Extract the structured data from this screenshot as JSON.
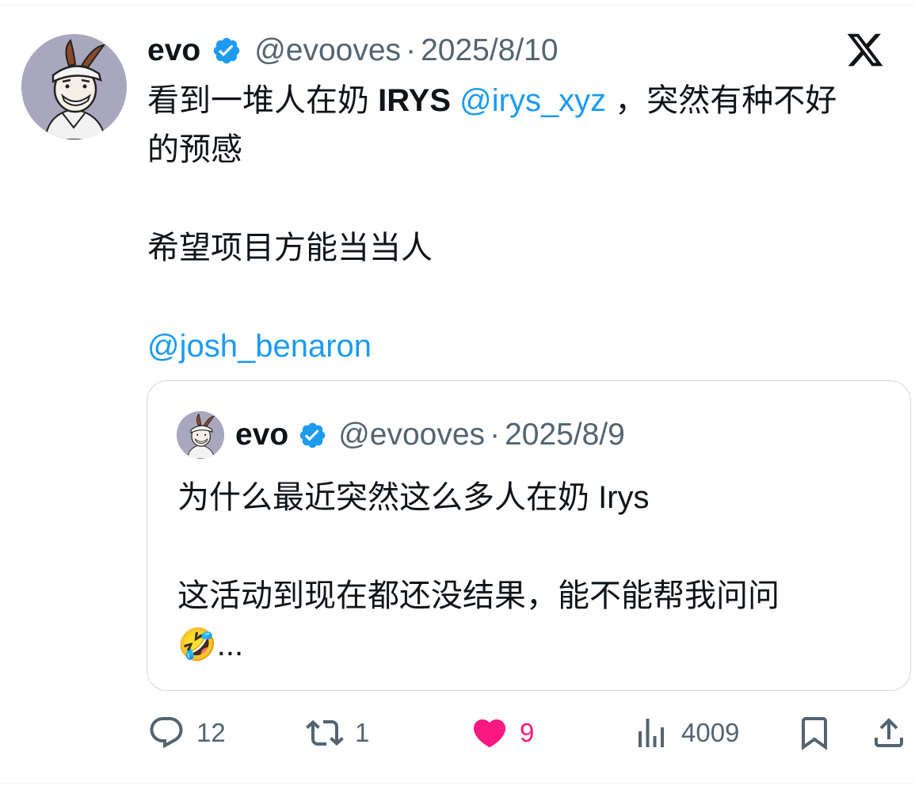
{
  "tweet": {
    "author_name": "evo",
    "handle": "@evooves",
    "separator": "·",
    "date": "2025/8/10",
    "line1_pre": "看到一堆人在奶 ",
    "line1_bold": "IRYS",
    "line1_space": " ",
    "line1_mention": "@irys_xyz",
    "line1_post": " ，突然有种不好",
    "line2": "的预感",
    "para2": "希望项目方能当当人",
    "mention2": "@josh_benaron"
  },
  "quoted": {
    "author_name": "evo",
    "handle": "@evooves",
    "separator": "·",
    "date": "2025/8/9",
    "para1": "为什么最近突然这么多人在奶 Irys",
    "para2_line1": "这活动到现在都还没结果，能不能帮我问问",
    "para2_line2": "🤣..."
  },
  "actions": {
    "replies": "12",
    "retweets": "1",
    "likes": "9",
    "views": "4009"
  },
  "icons": {
    "reply": "reply-icon",
    "retweet": "retweet-icon",
    "like": "heart-icon",
    "views": "views-icon",
    "bookmark": "bookmark-icon",
    "share": "share-icon",
    "verified": "verified-badge-icon",
    "logo": "x-logo-icon"
  },
  "colors": {
    "link": "#1d9bf0",
    "muted": "#536471",
    "like": "#f91880",
    "verified": "#1d9bf0",
    "text": "#0f1419"
  }
}
